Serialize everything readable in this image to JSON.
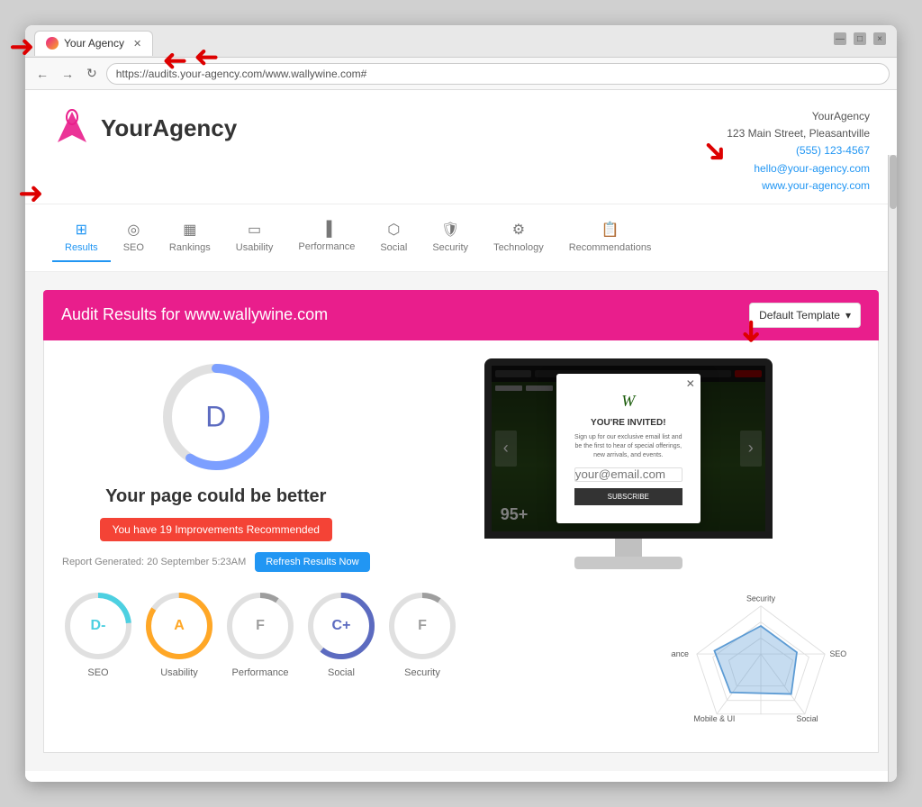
{
  "browser": {
    "tab_title": "Your Agency",
    "url": "https://audits.your-agency.com/www.wallywine.com#",
    "window_buttons": {
      "minimize": "—",
      "maximize": "□",
      "close": "×"
    }
  },
  "header": {
    "logo_text_light": "Your",
    "logo_text_bold": "Agency",
    "agency_name": "YourAgency",
    "address": "123 Main Street, Pleasantville",
    "phone": "(555) 123-4567",
    "email": "hello@your-agency.com",
    "website": "www.your-agency.com"
  },
  "nav": {
    "items": [
      {
        "id": "results",
        "label": "Results",
        "active": true
      },
      {
        "id": "seo",
        "label": "SEO",
        "active": false
      },
      {
        "id": "rankings",
        "label": "Rankings",
        "active": false
      },
      {
        "id": "usability",
        "label": "Usability",
        "active": false
      },
      {
        "id": "performance",
        "label": "Performance",
        "active": false
      },
      {
        "id": "social",
        "label": "Social",
        "active": false
      },
      {
        "id": "security",
        "label": "Security",
        "active": false
      },
      {
        "id": "technology",
        "label": "Technology",
        "active": false
      },
      {
        "id": "recommendations",
        "label": "Recommendations",
        "active": false
      }
    ]
  },
  "audit": {
    "title": "Audit Results for www.wallywine.com",
    "template_label": "Default Template",
    "grade": "D",
    "message": "Your page could be better",
    "improvements_badge": "You have 19 Improvements Recommended",
    "report_date": "Report Generated: 20 September 5:23AM",
    "refresh_btn": "Refresh Results Now",
    "popup": {
      "title": "YOU'RE INVITED!",
      "text": "Sign up for our exclusive email list and be the first to hear of special offerings, new arrivals, and events.",
      "input_placeholder": "your@email.com",
      "subscribe_btn": "SUBSCRIBE"
    },
    "site_number": "95+"
  },
  "scores": [
    {
      "id": "seo",
      "label": "SEO",
      "grade": "D-",
      "color": "#4dd0e1",
      "bg_color": "#e0f7fa",
      "stroke": "#4dd0e1"
    },
    {
      "id": "usability",
      "label": "Usability",
      "grade": "A",
      "color": "#ffa726",
      "bg_color": "#fff3e0",
      "stroke": "#ffa726"
    },
    {
      "id": "performance",
      "label": "Performance",
      "grade": "F",
      "color": "#bdbdbd",
      "bg_color": "#f5f5f5",
      "stroke": "#bdbdbd"
    },
    {
      "id": "social",
      "label": "Social",
      "grade": "C+",
      "color": "#5c6bc0",
      "bg_color": "#e8eaf6",
      "stroke": "#5c6bc0"
    },
    {
      "id": "security_score",
      "label": "Security",
      "grade": "F",
      "color": "#bdbdbd",
      "bg_color": "#f5f5f5",
      "stroke": "#bdbdbd"
    }
  ],
  "radar": {
    "labels": [
      "Security",
      "SEO",
      "Social",
      "Mobile & UI",
      "Performance"
    ],
    "accent_color": "#5c9bd4"
  }
}
